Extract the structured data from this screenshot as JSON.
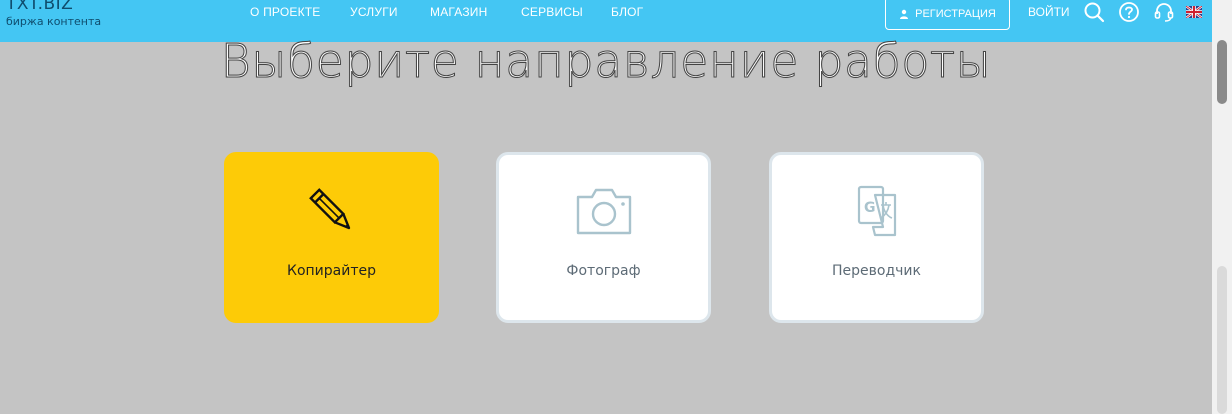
{
  "header": {
    "logo": {
      "mark": "TXT.BIZ",
      "subtitle": "биржа контента"
    },
    "nav": [
      {
        "label": "О ПРОЕКТЕ"
      },
      {
        "label": "УСЛУГИ"
      },
      {
        "label": "МАГАЗИН"
      },
      {
        "label": "СЕРВИСЫ"
      },
      {
        "label": "БЛОГ"
      }
    ],
    "register_label": "РЕГИСТРАЦИЯ",
    "login_label": "ВОЙТИ",
    "icons": [
      "search-icon",
      "help-icon",
      "support-headset-icon",
      "uk-flag-icon"
    ]
  },
  "main": {
    "title": "Выберите направление работы",
    "cards": [
      {
        "label": "Копирайтер",
        "icon": "pencil-icon",
        "active": true
      },
      {
        "label": "Фотограф",
        "icon": "camera-icon",
        "active": false
      },
      {
        "label": "Переводчик",
        "icon": "translate-icon",
        "active": false
      }
    ]
  },
  "colors": {
    "header_bg": "#44c6f3",
    "page_bg": "#c4c4c4",
    "active_card": "#fdcb07",
    "card_icon": "#a9c3cd"
  }
}
